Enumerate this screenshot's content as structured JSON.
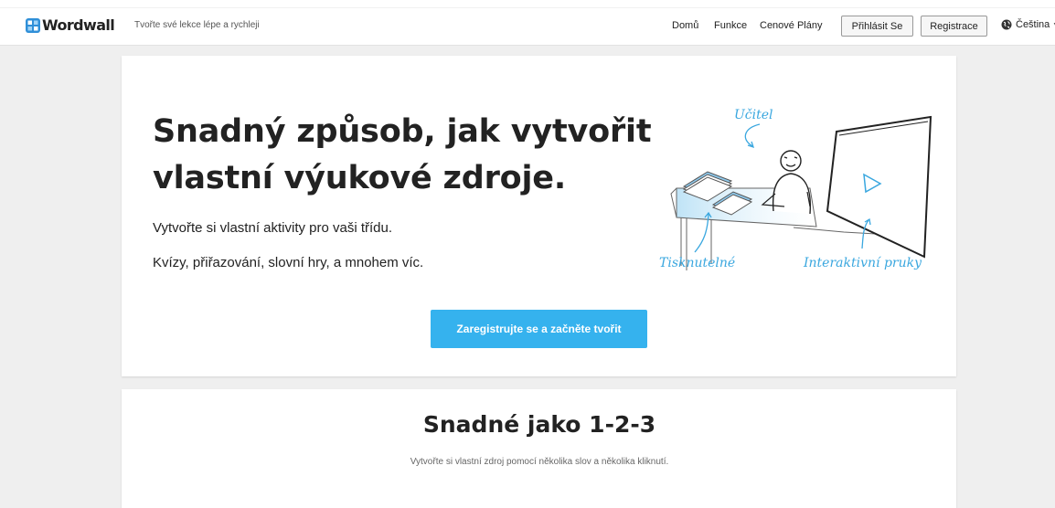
{
  "header": {
    "logo_text": "Wordwall",
    "tagline": "Tvořte své lekce lépe a rychleji",
    "nav": [
      "Domů",
      "Funkce",
      "Cenové Plány"
    ],
    "login_label": "Přihlásit Se",
    "register_label": "Registrace",
    "language": "Čeština"
  },
  "hero": {
    "title_line1": "Snadný způsob, jak vytvořit",
    "title_line2": "vlastní výukové zdroje.",
    "line1": "Vytvořte si vlastní aktivity pro vaši třídu.",
    "line2": "Kvízy, přiřazování, slovní hry, a mnohem víc.",
    "cta_label": "Zaregistrujte se a začněte tvořit",
    "illustration": {
      "teacher_label": "Učitel",
      "printable_label": "Tisknutelné",
      "interactive_label": "Interaktivní pruky"
    }
  },
  "section": {
    "title": "Snadné jako 1-2-3",
    "subtitle": "Vytvořte si vlastní zdroj pomocí několika slov a několika kliknutí."
  },
  "colors": {
    "accent": "#35b2ee",
    "handwriting": "#3aa7df",
    "page_bg": "#efefef"
  }
}
